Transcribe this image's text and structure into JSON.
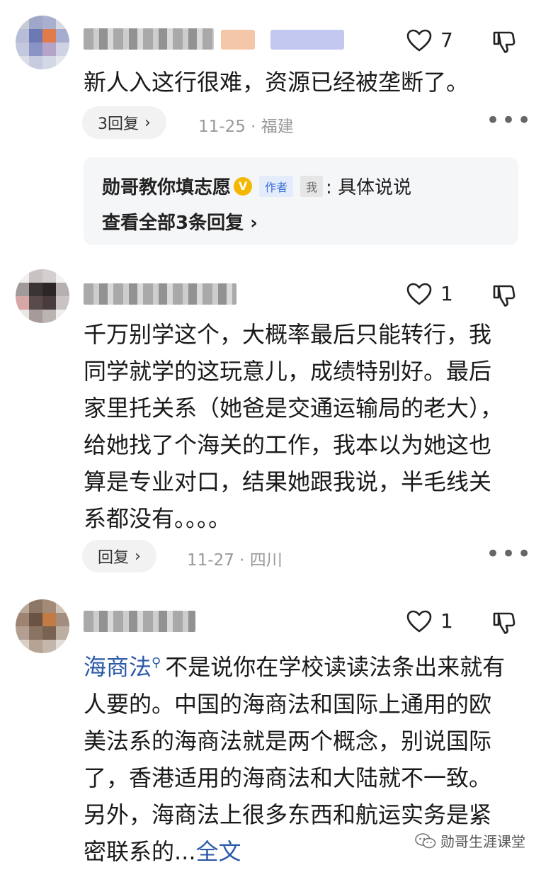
{
  "comments": [
    {
      "like_count": "7",
      "text": "新人入这行很难，资源已经被垄断了。",
      "reply_label": "3回复",
      "meta": "11-25 · 福建",
      "sub_reply": {
        "author": "勋哥教你填志愿",
        "verified_mark": "V",
        "badge_author": "作者",
        "badge_me": "我",
        "text": ": 具体说说",
        "view_all": "查看全部3条回复"
      }
    },
    {
      "like_count": "1",
      "text": "千万别学这个，大概率最后只能转行，我同学就学的这玩意儿，成绩特别好。最后家里托关系（她爸是交通运输局的老大），给她找了个海关的工作，我本以为她这也算是专业对口，结果她跟我说，半毛线关系都没有。。。。",
      "reply_label": "回复",
      "meta": "11-27 · 四川"
    },
    {
      "like_count": "1",
      "link_text": "海商法",
      "text": "不是说你在学校读读法条出来就有人要的。中国的海商法和国际上通用的欧美法系的海商法就是两个概念，别说国际了，香港适用的海商法和大陆就不一致。另外，海商法上很多东西和航运实务是紧密联系的...",
      "fulltext_label": "全文"
    }
  ],
  "watermark": "勋哥生涯课堂",
  "icons": {
    "like": "heart-outline-icon",
    "dislike": "thumbs-down-icon",
    "more": "more-dots-icon",
    "chevron": "chevron-right-icon",
    "search": "search-icon",
    "wechat": "wechat-icon"
  },
  "colors": {
    "link": "#2b5aa8",
    "author_badge_bg": "#e4ecfb",
    "verified": "#f5b800"
  }
}
